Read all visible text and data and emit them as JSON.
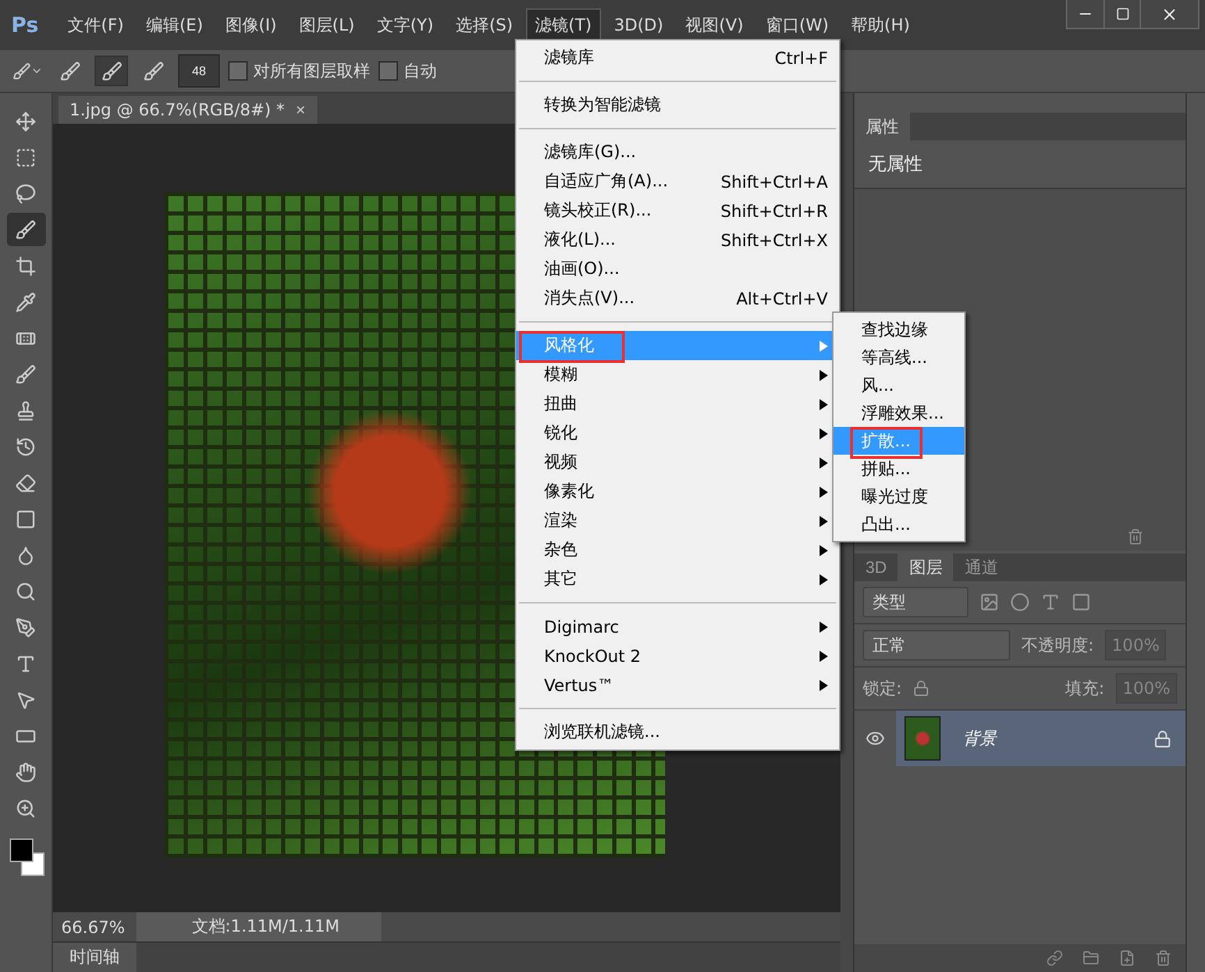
{
  "app": {
    "logo": "Ps"
  },
  "menu_bar": [
    {
      "label": "文件(F)",
      "selected": false
    },
    {
      "label": "编辑(E)",
      "selected": false
    },
    {
      "label": "图像(I)",
      "selected": false
    },
    {
      "label": "图层(L)",
      "selected": false
    },
    {
      "label": "文字(Y)",
      "selected": false
    },
    {
      "label": "选择(S)",
      "selected": false
    },
    {
      "label": "滤镜(T)",
      "selected": true
    },
    {
      "label": "3D(D)",
      "selected": false
    },
    {
      "label": "视图(V)",
      "selected": false
    },
    {
      "label": "窗口(W)",
      "selected": false
    },
    {
      "label": "帮助(H)",
      "selected": false
    }
  ],
  "options_bar": {
    "brush_size": "48",
    "modes": [
      {
        "selected": false
      },
      {
        "selected": true
      },
      {
        "selected": false
      }
    ],
    "checkboxes": [
      {
        "label": "对所有图层取样",
        "checked": false
      },
      {
        "label": "自动",
        "checked": false
      }
    ]
  },
  "document_tab": {
    "title": "1.jpg @ 66.7%(RGB/8#) *",
    "close": "×"
  },
  "tools": [
    {
      "kind": "move",
      "selected": false
    },
    {
      "kind": "marquee",
      "selected": false
    },
    {
      "kind": "lasso",
      "selected": false
    },
    {
      "kind": "quick",
      "selected": true
    },
    {
      "kind": "crop",
      "selected": false
    },
    {
      "kind": "eyedropper",
      "selected": false
    },
    {
      "kind": "heal",
      "selected": false
    },
    {
      "kind": "brush",
      "selected": false
    },
    {
      "kind": "stamp",
      "selected": false
    },
    {
      "kind": "history",
      "selected": false
    },
    {
      "kind": "eraser",
      "selected": false
    },
    {
      "kind": "gradient",
      "selected": false
    },
    {
      "kind": "blur",
      "selected": false
    },
    {
      "kind": "dodge",
      "selected": false
    },
    {
      "kind": "pen",
      "selected": false
    },
    {
      "kind": "type",
      "selected": false
    },
    {
      "kind": "select",
      "selected": false
    },
    {
      "kind": "shape",
      "selected": false
    },
    {
      "kind": "hand",
      "selected": false
    },
    {
      "kind": "zoom",
      "selected": false
    }
  ],
  "status_bar": {
    "zoom": "66.67%",
    "document": "文档:1.11M/1.11M"
  },
  "timeline": {
    "label": "时间轴"
  },
  "properties_panel": {
    "tab": "属性",
    "text": "无属性"
  },
  "layers_panel": {
    "tabs": [
      {
        "label": "3D",
        "selected": false
      },
      {
        "label": "图层",
        "selected": true
      },
      {
        "label": "通道",
        "selected": false
      }
    ],
    "filter": "类型",
    "blend_mode": "正常",
    "opacity_label": "不透明度:",
    "opacity": "100%",
    "lock_label": "锁定:",
    "fill_label": "填充:",
    "fill": "100%",
    "layers": [
      {
        "name": "背景",
        "visible": true,
        "selected": true,
        "locked": true
      }
    ]
  },
  "filter_menu": {
    "items": [
      {
        "kind": "item",
        "label": "滤镜库",
        "shortcut": "Ctrl+F",
        "submenu": false,
        "highlighted": false,
        "annotated": false
      },
      {
        "kind": "separator"
      },
      {
        "kind": "item",
        "label": "转换为智能滤镜",
        "submenu": false,
        "highlighted": false,
        "annotated": false
      },
      {
        "kind": "separator"
      },
      {
        "kind": "item",
        "label": "滤镜库(G)...",
        "submenu": false,
        "highlighted": false,
        "annotated": false
      },
      {
        "kind": "item",
        "label": "自适应广角(A)...",
        "shortcut": "Shift+Ctrl+A",
        "submenu": false,
        "highlighted": false,
        "annotated": false
      },
      {
        "kind": "item",
        "label": "镜头校正(R)...",
        "shortcut": "Shift+Ctrl+R",
        "submenu": false,
        "highlighted": false,
        "annotated": false
      },
      {
        "kind": "item",
        "label": "液化(L)...",
        "shortcut": "Shift+Ctrl+X",
        "submenu": false,
        "highlighted": false,
        "annotated": false
      },
      {
        "kind": "item",
        "label": "油画(O)...",
        "submenu": false,
        "highlighted": false,
        "annotated": false
      },
      {
        "kind": "item",
        "label": "消失点(V)...",
        "shortcut": "Alt+Ctrl+V",
        "submenu": false,
        "highlighted": false,
        "annotated": false
      },
      {
        "kind": "separator"
      },
      {
        "kind": "item",
        "label": "风格化",
        "submenu": true,
        "highlighted": true,
        "annotated": true
      },
      {
        "kind": "item",
        "label": "模糊",
        "submenu": true,
        "highlighted": false,
        "annotated": false
      },
      {
        "kind": "item",
        "label": "扭曲",
        "submenu": true,
        "highlighted": false,
        "annotated": false
      },
      {
        "kind": "item",
        "label": "锐化",
        "submenu": true,
        "highlighted": false,
        "annotated": false
      },
      {
        "kind": "item",
        "label": "视频",
        "submenu": true,
        "highlighted": false,
        "annotated": false
      },
      {
        "kind": "item",
        "label": "像素化",
        "submenu": true,
        "highlighted": false,
        "annotated": false
      },
      {
        "kind": "item",
        "label": "渲染",
        "submenu": true,
        "highlighted": false,
        "annotated": false
      },
      {
        "kind": "item",
        "label": "杂色",
        "submenu": true,
        "highlighted": false,
        "annotated": false
      },
      {
        "kind": "item",
        "label": "其它",
        "submenu": true,
        "highlighted": false,
        "annotated": false
      },
      {
        "kind": "separator"
      },
      {
        "kind": "item",
        "label": "Digimarc",
        "submenu": true,
        "highlighted": false,
        "annotated": false
      },
      {
        "kind": "item",
        "label": "KnockOut 2",
        "submenu": true,
        "highlighted": false,
        "annotated": false
      },
      {
        "kind": "item",
        "label": "Vertus™",
        "submenu": true,
        "highlighted": false,
        "annotated": false
      },
      {
        "kind": "separator"
      },
      {
        "kind": "item",
        "label": "浏览联机滤镜...",
        "submenu": false,
        "highlighted": false,
        "annotated": false
      }
    ]
  },
  "stylize_submenu": {
    "items": [
      {
        "label": "查找边缘",
        "highlighted": false,
        "annotated": false
      },
      {
        "label": "等高线...",
        "highlighted": false,
        "annotated": false
      },
      {
        "label": "风...",
        "highlighted": false,
        "annotated": false
      },
      {
        "label": "浮雕效果...",
        "highlighted": false,
        "annotated": false
      },
      {
        "label": "扩散...",
        "highlighted": true,
        "annotated": true
      },
      {
        "label": "拼贴...",
        "highlighted": false,
        "annotated": false
      },
      {
        "label": "曝光过度",
        "highlighted": false,
        "annotated": false
      },
      {
        "label": "凸出...",
        "highlighted": false,
        "annotated": false
      }
    ]
  }
}
